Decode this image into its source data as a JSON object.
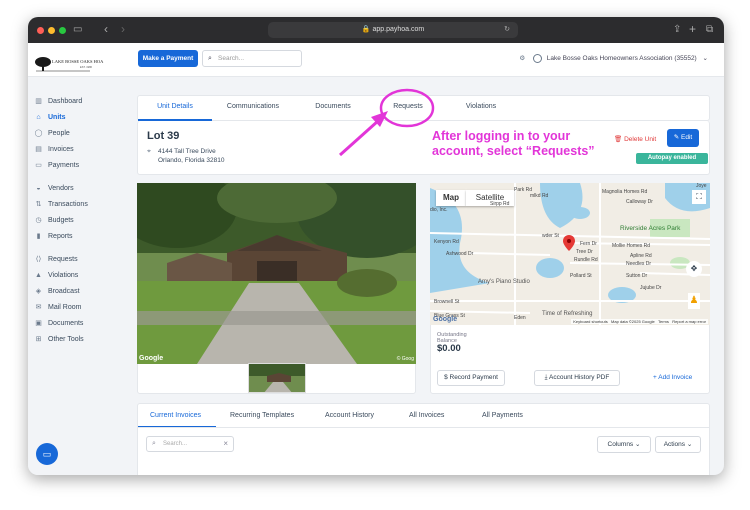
{
  "browser": {
    "url": "app.payhoa.com"
  },
  "brand": {
    "logo_text": "LAKE BOSSE OAKS HOA",
    "logo_est": "EST. 1986"
  },
  "header": {
    "make_payment": "Make a Payment",
    "search_placeholder": "Search...",
    "association": "Lake Bosse Oaks Homeowners Association (35552)"
  },
  "sidebar": {
    "items": [
      {
        "label": "Dashboard",
        "icon": "dashboard-icon"
      },
      {
        "label": "Units",
        "icon": "home-icon"
      },
      {
        "label": "People",
        "icon": "person-icon"
      },
      {
        "label": "Invoices",
        "icon": "invoice-icon"
      },
      {
        "label": "Payments",
        "icon": "card-icon"
      },
      {
        "label": "Vendors",
        "icon": "vendor-icon"
      },
      {
        "label": "Transactions",
        "icon": "transactions-icon"
      },
      {
        "label": "Budgets",
        "icon": "budget-icon"
      },
      {
        "label": "Reports",
        "icon": "reports-icon"
      },
      {
        "label": "Requests",
        "icon": "requests-icon"
      },
      {
        "label": "Violations",
        "icon": "warning-icon"
      },
      {
        "label": "Broadcast",
        "icon": "broadcast-icon"
      },
      {
        "label": "Mail Room",
        "icon": "mail-icon"
      },
      {
        "label": "Documents",
        "icon": "documents-icon"
      },
      {
        "label": "Other Tools",
        "icon": "tools-icon"
      }
    ]
  },
  "tabs": [
    "Unit Details",
    "Communications",
    "Documents",
    "Requests",
    "Violations"
  ],
  "unit": {
    "title": "Lot 39",
    "address_line1": "4144 Tall Tree Drive",
    "address_line2": "Orlando, Florida 32810",
    "delete": "Delete Unit",
    "edit": "Edit",
    "autopay": "Autopay enabled"
  },
  "annotation": {
    "line1": "After logging in to your",
    "line2": "account, select “Requests”"
  },
  "map": {
    "tab_map": "Map",
    "tab_satellite": "Satellite",
    "labels": [
      "Riverside Acres Park",
      "Amy's Piano Studio",
      "Time of Refreshing",
      "Kenyon Rd",
      "Ashwood Dr",
      "Sutton Dr",
      "Needles Dr",
      "Jujube Dr",
      "Rundle Rd",
      "Tree Dr",
      "Brownell St",
      "Blue Grass St",
      "Calloway Dr",
      "Magnolia Homes Rd",
      "Sirpp Rd",
      "Pollard St",
      "Apline Rd",
      "Park Rd",
      "Mollie Homes Rd",
      "dio, Inc.",
      "Joye",
      "Fern Dr",
      "Eden",
      "mlkd Rd",
      "wder St"
    ],
    "footer": [
      "Keyboard shortcuts",
      "Map data ©2025 Google",
      "Terms",
      "Report a map error"
    ],
    "google": "Google"
  },
  "photo": {
    "watermark": "Google",
    "copyright": "© Goog"
  },
  "balance": {
    "label_line1": "Outstanding",
    "label_line2": "Balance",
    "amount": "$0.00"
  },
  "actions": {
    "record": "Record Payment",
    "history": "Account History PDF",
    "add": "+ Add Invoice"
  },
  "subtabs": [
    "Current Invoices",
    "Recurring Templates",
    "Account History",
    "All Invoices",
    "All Payments"
  ],
  "invoice_search_placeholder": "Search...",
  "columns": "Columns",
  "actions_dd": "Actions"
}
